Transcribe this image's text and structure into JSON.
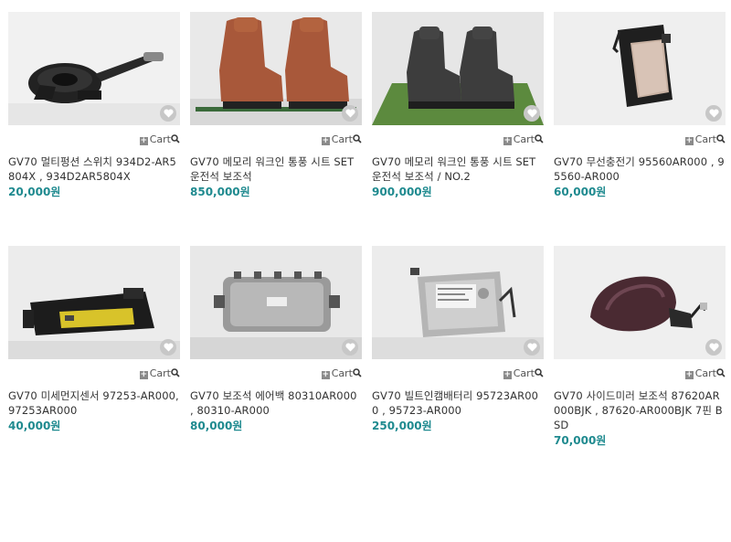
{
  "cart_label": "Cart",
  "accent_price_color": "#1f8a8f",
  "products": [
    {
      "title": "GV70 멀티펑션 스위치 934D2-AR5804X , 934D2AR5804X",
      "price": "20,000원",
      "image": "multifunction-switch"
    },
    {
      "title": "GV70 메모리 워크인 통풍 시트 SET 운전석 보조석",
      "price": "850,000원",
      "image": "brown-leather-seats"
    },
    {
      "title": "GV70 메모리 워크인 통풍 시트 SET 운전석 보조석 / NO.2",
      "price": "900,000원",
      "image": "gray-leather-seats"
    },
    {
      "title": "GV70 무선충전기 95560AR000 , 95560-AR000",
      "price": "60,000원",
      "image": "wireless-charger"
    },
    {
      "title": "GV70 미세먼지센서 97253-AR000, 97253AR000",
      "price": "40,000원",
      "image": "dust-sensor"
    },
    {
      "title": "GV70 보조석 에어백 80310AR000 , 80310-AR000",
      "price": "80,000원",
      "image": "passenger-airbag"
    },
    {
      "title": "GV70 빌트인캠배터리 95723AR000 , 95723-AR000",
      "price": "250,000원",
      "image": "builtin-cam-battery"
    },
    {
      "title": "GV70 사이드미러 보조석 87620AR000BJK , 87620-AR000BJK 7핀 BSD",
      "price": "70,000원",
      "image": "side-mirror"
    }
  ]
}
